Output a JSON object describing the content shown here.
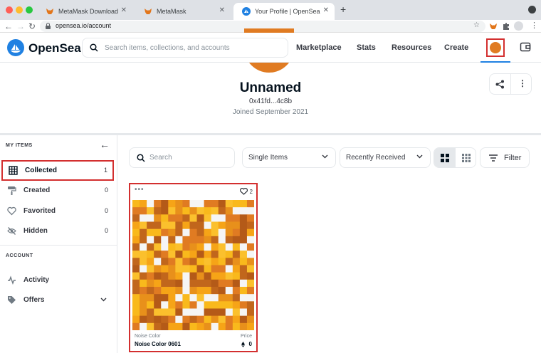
{
  "browser": {
    "tabs": [
      {
        "title": "MetaMask Download"
      },
      {
        "title": "MetaMask"
      },
      {
        "title": "Your Profile | OpenSea"
      }
    ],
    "url": "opensea.io/account"
  },
  "header": {
    "brand": "OpenSea",
    "search_placeholder": "Search items, collections, and accounts",
    "nav": [
      "Marketplace",
      "Stats",
      "Resources",
      "Create"
    ]
  },
  "profile": {
    "name": "Unnamed",
    "address": "0x41fd...4c8b",
    "joined": "Joined September 2021"
  },
  "sidebar": {
    "my_items_heading": "MY ITEMS",
    "items": [
      {
        "label": "Collected",
        "count": "1",
        "icon": "grid-icon"
      },
      {
        "label": "Created",
        "count": "0",
        "icon": "paint-roller-icon"
      },
      {
        "label": "Favorited",
        "count": "0",
        "icon": "heart-icon"
      },
      {
        "label": "Hidden",
        "count": "0",
        "icon": "eye-off-icon"
      }
    ],
    "account_heading": "ACCOUNT",
    "account_items": [
      {
        "label": "Activity",
        "icon": "activity-icon"
      },
      {
        "label": "Offers",
        "icon": "tag-icon"
      }
    ]
  },
  "toolbar": {
    "search_placeholder": "Search",
    "type_select": "Single Items",
    "sort_select": "Recently Received",
    "filter_label": "Filter"
  },
  "card": {
    "favorites": "2",
    "collection": "Noise Color",
    "name": "Noise Color 0601",
    "price_label": "Price",
    "price": "0"
  },
  "colors": {
    "accent": "#2081e2",
    "avatar": "#e07b22",
    "highlight": "#d32f2f"
  }
}
